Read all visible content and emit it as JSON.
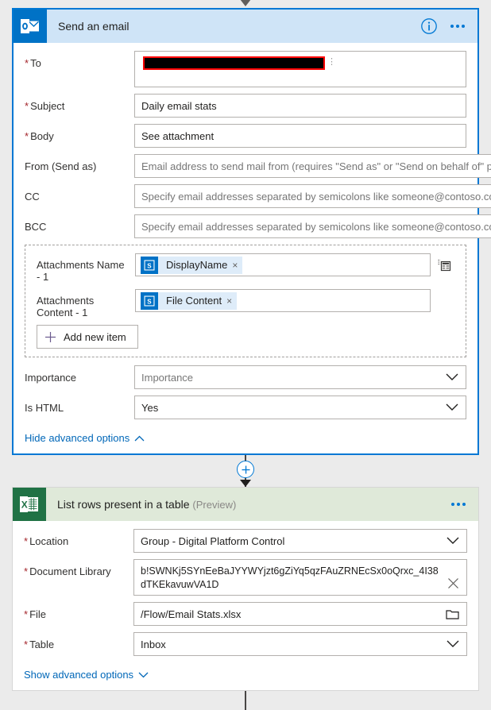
{
  "colors": {
    "accent": "#0078d4",
    "outlook_brand": "#0072c6",
    "excel_brand": "#207245",
    "outlook_header_bg": "#cfe4f7",
    "excel_header_bg": "#dfe9d9",
    "required_asterisk": "#a4262c",
    "link": "#0067b8",
    "redaction_fill": "#000000",
    "redaction_outline": "#ff0000"
  },
  "outlook_card": {
    "icon": "outlook-icon",
    "title": "Send an email",
    "info_icon": "info-icon",
    "more_icon": "ellipsis-icon",
    "fields": {
      "to": {
        "label": "To",
        "required": true,
        "value_redacted": true
      },
      "subject": {
        "label": "Subject",
        "required": true,
        "value": "Daily email stats"
      },
      "body": {
        "label": "Body",
        "required": true,
        "value": "See attachment"
      },
      "from": {
        "label": "From (Send as)",
        "required": false,
        "placeholder": "Email address to send mail from (requires \"Send as\" or \"Send on behalf of\" pe"
      },
      "cc": {
        "label": "CC",
        "required": false,
        "placeholder": "Specify email addresses separated by semicolons like someone@contoso.com"
      },
      "bcc": {
        "label": "BCC",
        "required": false,
        "placeholder": "Specify email addresses separated by semicolons like someone@contoso.com"
      },
      "importance": {
        "label": "Importance",
        "required": false,
        "placeholder": "Importance"
      },
      "is_html": {
        "label": "Is HTML",
        "required": false,
        "value": "Yes"
      }
    },
    "attachments": {
      "name_label": "Attachments Name - 1",
      "name_token": "DisplayName",
      "name_token_icon": "sharepoint-icon",
      "content_label": "Attachments Content - 1",
      "content_token": "File Content",
      "content_token_icon": "sharepoint-icon",
      "add_item_label": "Add new item",
      "array_toggle_icon": "switch-to-array-icon",
      "remove_token_label": "×"
    },
    "advanced_toggle": {
      "label": "Hide advanced options",
      "icon": "chevron-up-icon"
    }
  },
  "add_step_button": {
    "icon": "plus-icon",
    "name": "insert-new-step"
  },
  "excel_card": {
    "icon": "excel-icon",
    "title": "List rows present in a table",
    "preview_tag": "(Preview)",
    "more_icon": "ellipsis-icon",
    "fields": {
      "location": {
        "label": "Location",
        "required": true,
        "value": "Group - Digital Platform Control",
        "icon": "chevron-down-icon"
      },
      "document_library": {
        "label": "Document Library",
        "required": true,
        "value": "b!SWNKj5SYnEeBaJYYWYjzt6gZiYq5qzFAuZRNEcSx0oQrxc_4I38dTKEkavuwVA1D",
        "icon": "clear-icon"
      },
      "file": {
        "label": "File",
        "required": true,
        "value": "/Flow/Email Stats.xlsx",
        "icon": "folder-picker-icon"
      },
      "table": {
        "label": "Table",
        "required": true,
        "value": "Inbox",
        "icon": "chevron-down-icon"
      }
    },
    "advanced_toggle": {
      "label": "Show advanced options",
      "icon": "chevron-down-icon"
    }
  }
}
